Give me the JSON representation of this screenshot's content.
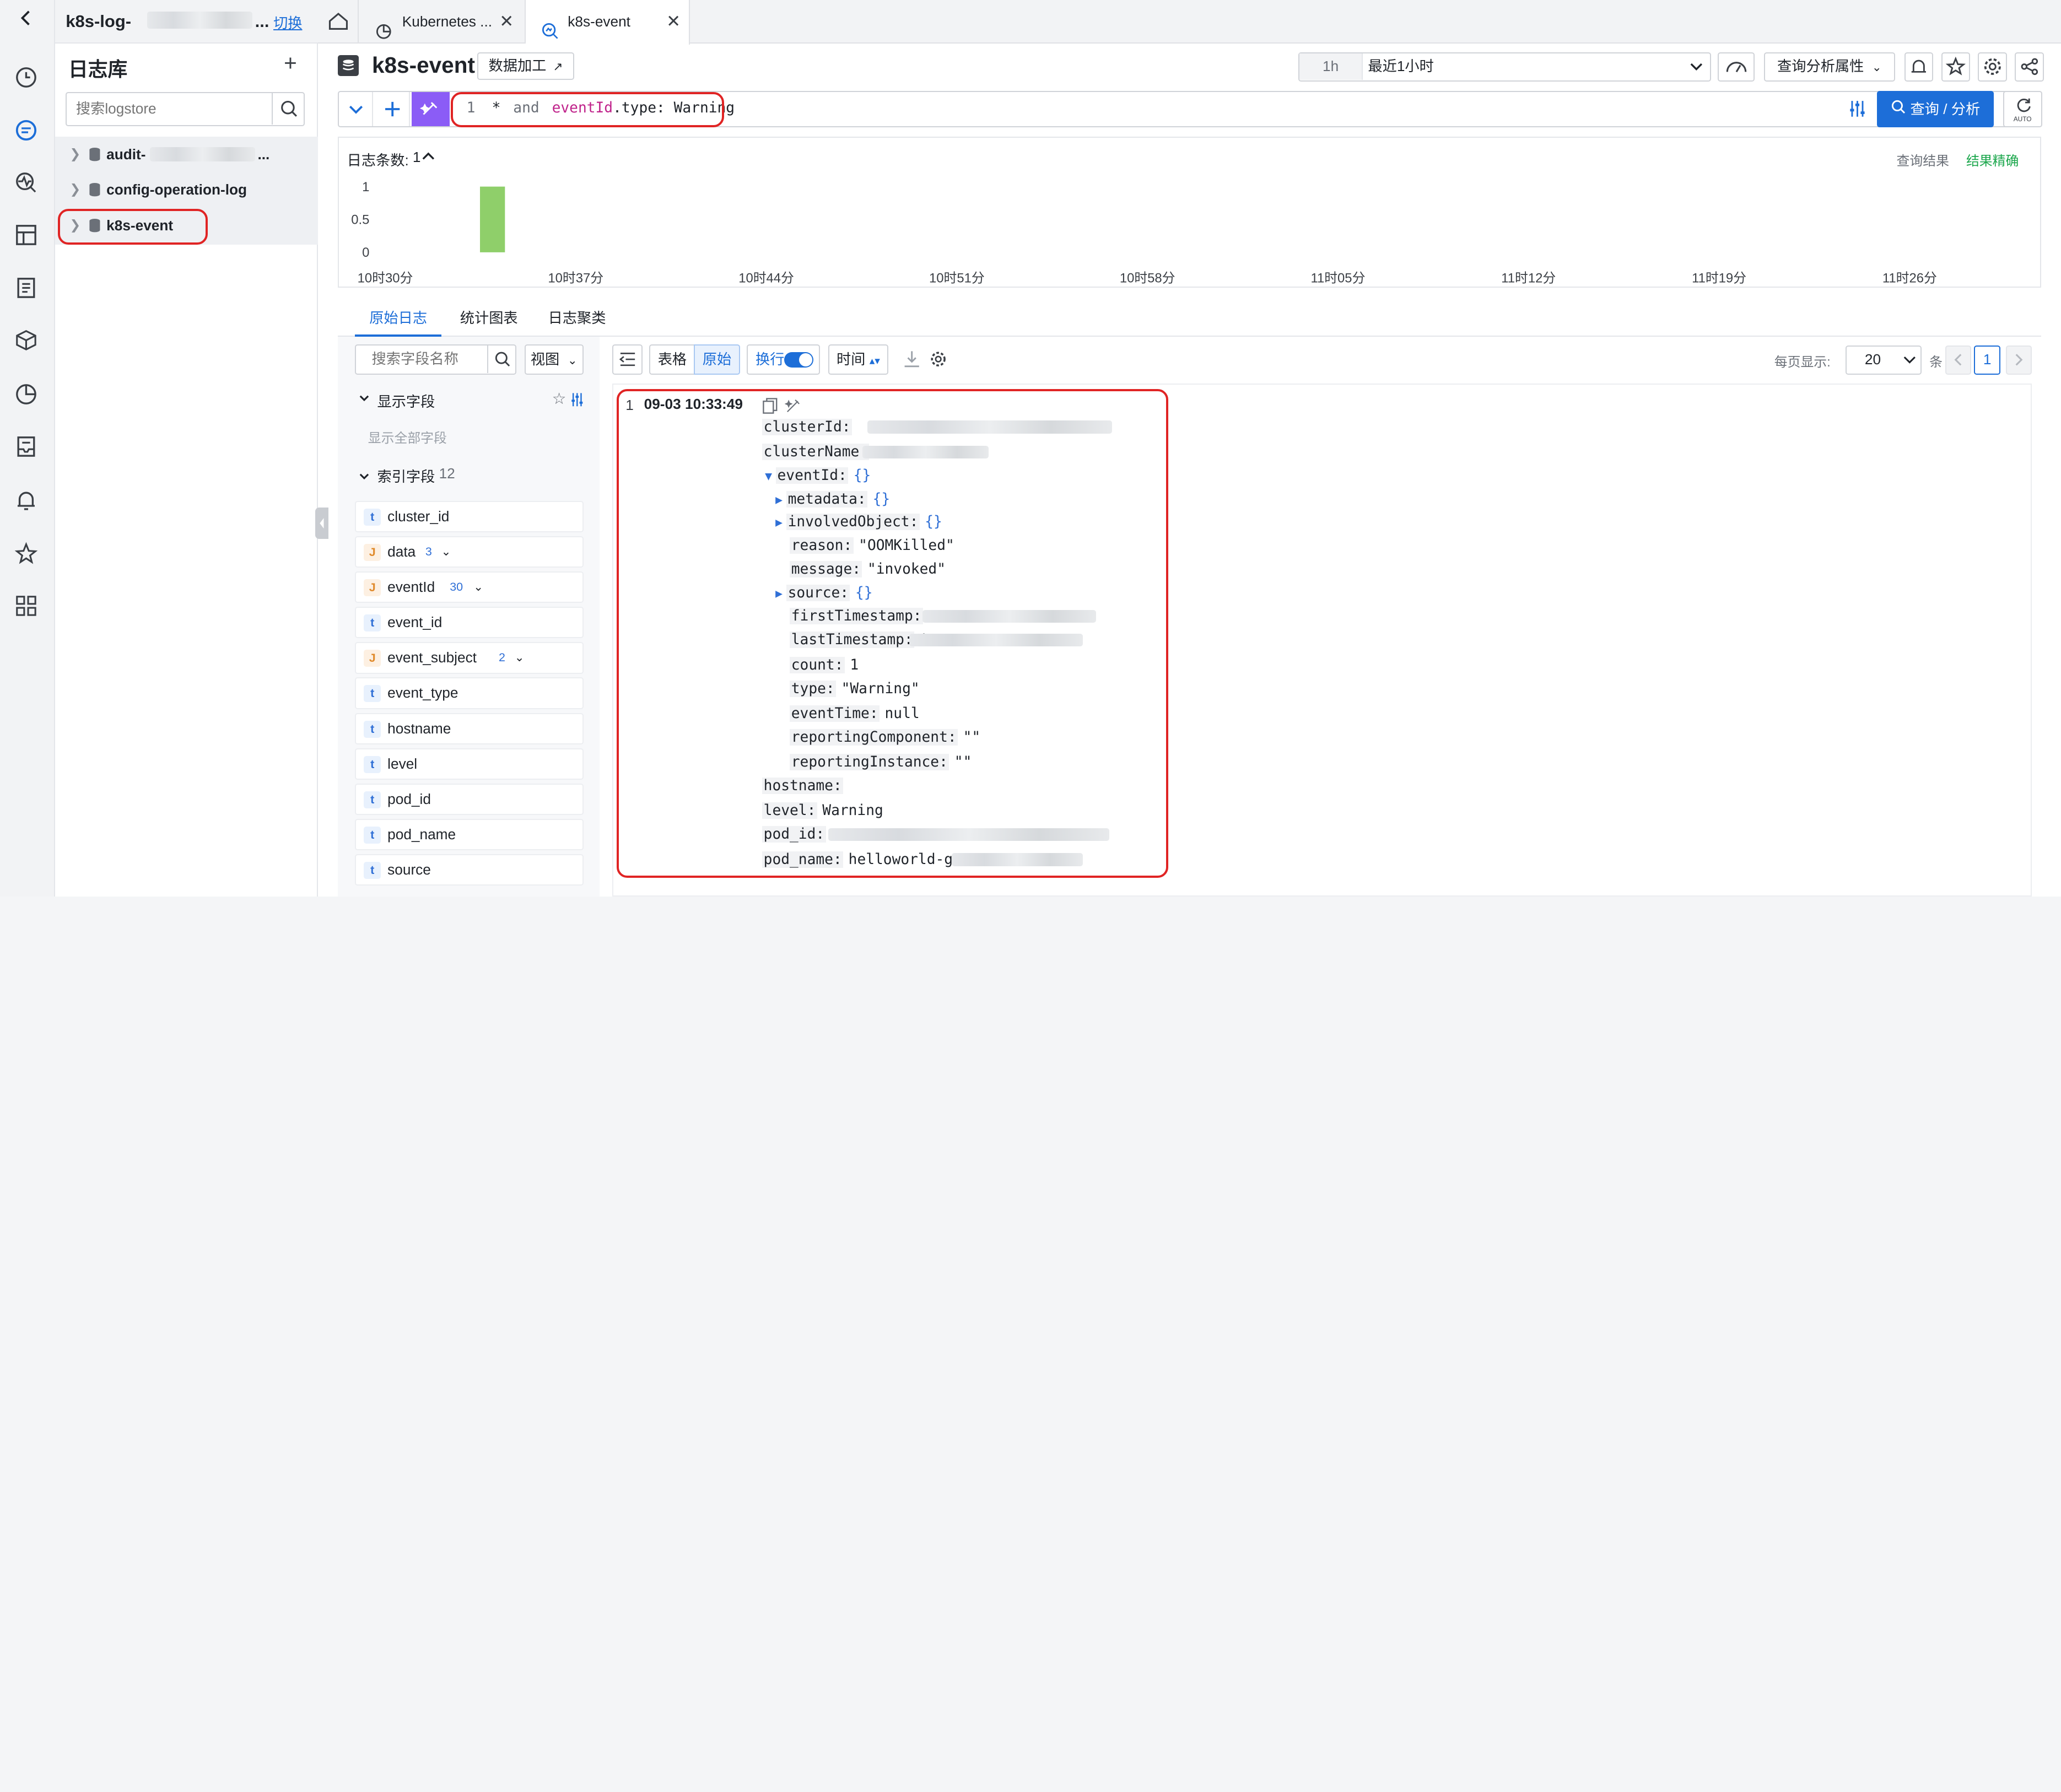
{
  "app": {
    "title": "k8s-log-",
    "switch_label": "切换",
    "back_icon": "chevron-left-icon"
  },
  "tabs": [
    {
      "label": "Kubernetes ...",
      "icon": "pie-icon"
    },
    {
      "label": "k8s-event",
      "icon": "search-chart-icon",
      "active": true
    }
  ],
  "sidebar": {
    "title": "日志库",
    "add_label": "+",
    "search_placeholder": "搜索logstore",
    "items": [
      {
        "label": "audit-",
        "suffix": "..."
      },
      {
        "label": "config-operation-log"
      },
      {
        "label": "k8s-event",
        "selected": true
      }
    ]
  },
  "header": {
    "logstore_name": "k8s-event",
    "data_process_label": "数据加工",
    "time_badge": "1h",
    "time_range": "最近1小时",
    "query_props_label": "查询分析属性"
  },
  "query": {
    "line_no": "1",
    "star": "*",
    "and": "and",
    "field": "eventId",
    "rest": ".type: Warning",
    "search_button": "查询 / 分析",
    "auto_label": "AUTO"
  },
  "histogram": {
    "count_label": "日志条数:",
    "count_value": "1",
    "result_label": "查询结果",
    "accuracy_label": "结果精确",
    "accent": "#1aa64b",
    "chart_data": {
      "type": "bar",
      "y_ticks": [
        "1",
        "0.5",
        "0"
      ],
      "ylim": [
        0,
        1
      ],
      "x_ticks": [
        "10时30分",
        "10时37分",
        "10时44分",
        "10时51分",
        "10时58分",
        "11时05分",
        "11时12分",
        "11时19分",
        "11时26分"
      ],
      "bars": [
        {
          "x": "10时33分",
          "value": 1
        }
      ],
      "color": "#8fcf6a"
    }
  },
  "result_tabs": [
    {
      "label": "原始日志",
      "active": true
    },
    {
      "label": "统计图表"
    },
    {
      "label": "日志聚类"
    }
  ],
  "fields_panel": {
    "search_placeholder": "搜索字段名称",
    "view_label": "视图",
    "display_fields_label": "显示字段",
    "show_all_label": "显示全部字段",
    "index_fields_label": "索引字段",
    "index_count": "12",
    "fields": [
      {
        "type": "t",
        "name": "cluster_id",
        "count": ""
      },
      {
        "type": "J",
        "name": "data",
        "count": "3"
      },
      {
        "type": "J",
        "name": "eventId",
        "count": "30"
      },
      {
        "type": "t",
        "name": "event_id",
        "count": ""
      },
      {
        "type": "J",
        "name": "event_subject",
        "count": "2"
      },
      {
        "type": "t",
        "name": "event_type",
        "count": ""
      },
      {
        "type": "t",
        "name": "hostname",
        "count": ""
      },
      {
        "type": "t",
        "name": "level",
        "count": ""
      },
      {
        "type": "t",
        "name": "pod_id",
        "count": ""
      },
      {
        "type": "t",
        "name": "pod_name",
        "count": ""
      },
      {
        "type": "t",
        "name": "source",
        "count": ""
      }
    ]
  },
  "log_toolbar": {
    "table_label": "表格",
    "raw_label": "原始",
    "wrap_label": "换行",
    "time_label": "时间",
    "per_page_label": "每页显示:",
    "per_page_value": "20",
    "unit_label": "条",
    "page": "1"
  },
  "log_entry": {
    "index": "1",
    "time": "09-03 10:33:49",
    "lines": [
      {
        "key": "clusterId:",
        "value": ""
      },
      {
        "key": "clusterName:",
        "value": ""
      },
      {
        "key": "eventId:",
        "value": "{}"
      },
      {
        "key": "metadata:",
        "value": "{}"
      },
      {
        "key": "involvedObject:",
        "value": "{}"
      },
      {
        "key": "reason:",
        "value": "\"OOMKilled\""
      },
      {
        "key": "message:",
        "value": "\"invoked\""
      },
      {
        "key": "source:",
        "value": "{}"
      },
      {
        "key": "firstTimestamp:",
        "value": ""
      },
      {
        "key": "lastTimestamp:",
        "value": "'"
      },
      {
        "key": "count:",
        "value": "1"
      },
      {
        "key": "type:",
        "value": "\"Warning\""
      },
      {
        "key": "eventTime:",
        "value": "null"
      },
      {
        "key": "reportingComponent:",
        "value": "\"\""
      },
      {
        "key": "reportingInstance:",
        "value": "\"\""
      },
      {
        "key": "hostname:",
        "value": ""
      },
      {
        "key": "level:",
        "value": "Warning"
      },
      {
        "key": "pod_id:",
        "value": ""
      },
      {
        "key": "pod_name:",
        "value": "helloworld-go-"
      }
    ]
  },
  "colors": {
    "primary": "#1d6ed8",
    "highlight_red": "#e02424",
    "query_key": "#c0238b"
  }
}
